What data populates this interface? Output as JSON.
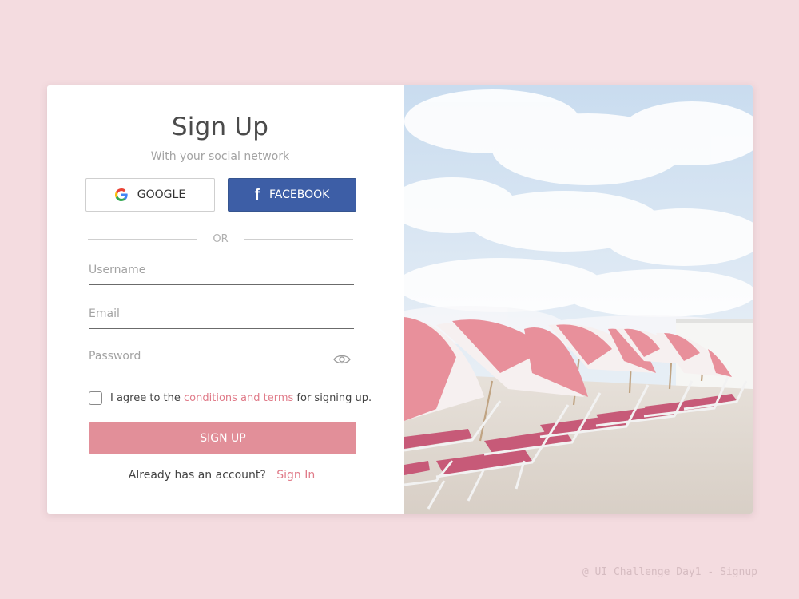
{
  "signup": {
    "title": "Sign Up",
    "subtitle": "With your social network",
    "google_label": "GOOGLE",
    "facebook_label": "FACEBOOK",
    "divider_text": "OR",
    "username_placeholder": "Username",
    "email_placeholder": "Email",
    "password_placeholder": "Password",
    "terms_prefix": "I agree to the",
    "terms_link": "conditions and terms",
    "terms_suffix": "for signing up.",
    "submit_label": "SIGN UP",
    "signin_prompt": "Already has an account?",
    "signin_link": "Sign In"
  },
  "icons": {
    "google": "google-icon",
    "facebook": "facebook-icon",
    "eye": "eye-icon"
  },
  "colors": {
    "background": "#f4dce0",
    "accent_pink": "#e28f99",
    "link_pink": "#e07b89",
    "facebook_blue": "#3d5ea6"
  },
  "footer": {
    "credit": "@ UI Challenge Day1 - Signup"
  }
}
